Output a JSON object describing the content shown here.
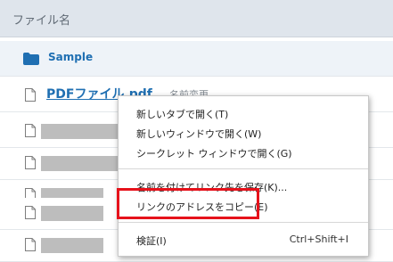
{
  "header": {
    "column_title": "ファイル名"
  },
  "folder": {
    "name": "Sample",
    "icon": "folder-icon"
  },
  "file": {
    "name": "PDFファイル.pdf",
    "action": "名前変更",
    "icon": "file-icon"
  },
  "context_menu": {
    "items": [
      {
        "label": "新しいタブで開く(T)"
      },
      {
        "label": "新しいウィンドウで開く(W)"
      },
      {
        "label": "シークレット ウィンドウで開く(G)"
      },
      {
        "label": "名前を付けてリンク先を保存(K)..."
      },
      {
        "label": "リンクのアドレスをコピー(E)"
      },
      {
        "label": "検証(I)",
        "shortcut": "Ctrl+Shift+I"
      }
    ]
  },
  "colors": {
    "link": "#1f6fb2",
    "highlight": "#e6121b",
    "header_bg": "#dfe5ec"
  }
}
